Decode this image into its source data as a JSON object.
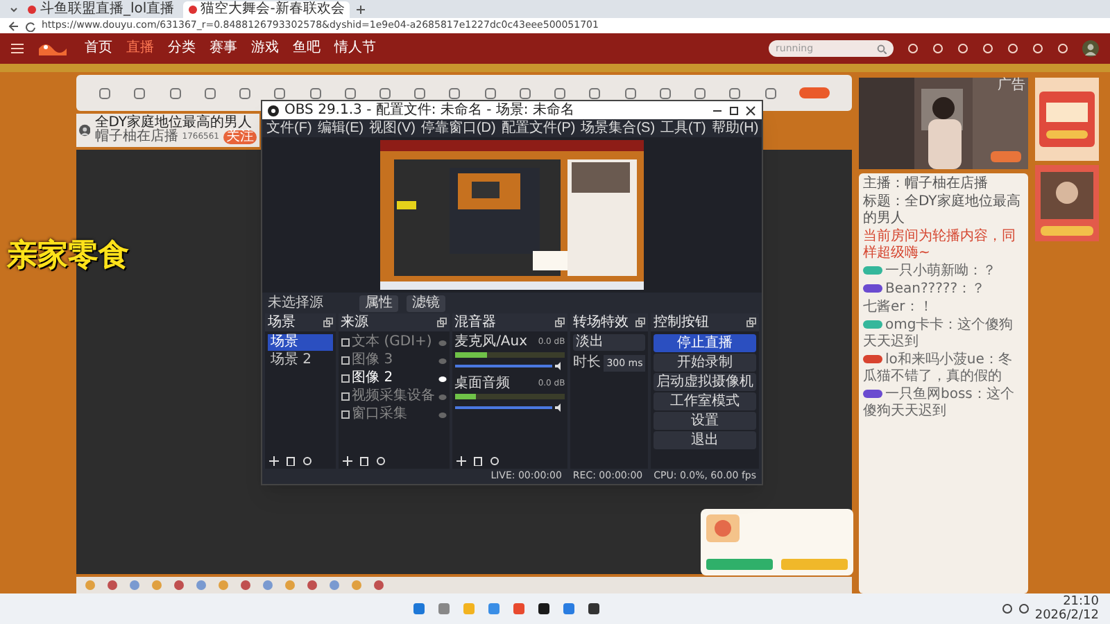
{
  "browser": {
    "tabs": [
      {
        "label": "斗鱼联盟直播_lol直播",
        "selected": false
      },
      {
        "label": "猫空大舞会-新春联欢会",
        "selected": true
      }
    ],
    "url": "https://www.douyu.com/631367_r=0.8488126793302578&dyshid=1e9e04-a2685817e1227dc0c43eee500051701"
  },
  "nav": [
    {
      "label": "首页",
      "selected": false
    },
    {
      "label": "直播",
      "selected": true
    },
    {
      "label": "分类",
      "selected": false
    },
    {
      "label": "赛事",
      "selected": false
    },
    {
      "label": "游戏",
      "selected": false
    },
    {
      "label": "鱼吧",
      "selected": false
    },
    {
      "label": "情人节",
      "selected": false
    }
  ],
  "search": {
    "placeholder": "running"
  },
  "room": {
    "title": "全DY家庭地位最高的男人",
    "follow": "关注",
    "streamer": "帽子柚在店播",
    "heat": "1766561"
  },
  "video": {
    "caption": "亲家零食"
  },
  "obs": {
    "title": "OBS 29.1.3 - 配置文件: 未命名 - 场景: 未命名",
    "menu": [
      "文件(F)",
      "编辑(E)",
      "视图(V)",
      "停靠窗口(D)",
      "配置文件(P)",
      "场景集合(S)",
      "工具(T)",
      "帮助(H)"
    ],
    "source_bar": {
      "label": "未选择源",
      "buttons": [
        "属性",
        "滤镜"
      ]
    },
    "docks": [
      "场景",
      "来源",
      "混音器",
      "转场特效",
      "控制按钮"
    ],
    "scenes": [
      {
        "label": "场景",
        "selected": true
      },
      {
        "label": "场景 2",
        "selected": false
      }
    ],
    "sources": [
      {
        "label": "文本 (GDI+)",
        "visible": false
      },
      {
        "label": "图像 3",
        "visible": false
      },
      {
        "label": "图像 2",
        "visible": true
      },
      {
        "label": "视频采集设备",
        "visible": false
      },
      {
        "label": "窗口采集",
        "visible": false
      }
    ],
    "mixer": [
      {
        "name": "麦克风/Aux",
        "reading": "0.0 dB",
        "meter": {
          "level": 0.3
        },
        "volume": {
          "level": 1
        }
      },
      {
        "name": "桌面音频",
        "reading": "0.0 dB",
        "meter": {
          "level": 0.2
        },
        "volume": {
          "level": 1
        }
      }
    ],
    "transition": {
      "type": "淡出",
      "duration_label": "时长",
      "duration": "300 ms"
    },
    "controls": [
      {
        "label": "停止直播",
        "active": true
      },
      {
        "label": "开始录制",
        "active": false
      },
      {
        "label": "启动虚拟摄像机",
        "active": false
      },
      {
        "label": "工作室模式",
        "active": false
      },
      {
        "label": "设置",
        "active": false
      },
      {
        "label": "退出",
        "active": false
      }
    ],
    "status": {
      "live": "LIVE: 00:00:00",
      "rec": "REC: 00:00:00",
      "cpu": "CPU: 0.0%, 60.00 fps"
    }
  },
  "ad": {
    "label": "广告"
  },
  "chat": {
    "info": [
      "主播：帽子柚在店播",
      "标题：全DY家庭地位最高的男人"
    ],
    "notice": "当前房间为轮播内容，同样超级嗨~",
    "messages": [
      {
        "user": "一只小萌新呦：",
        "text": "？",
        "color": "#35b79b"
      },
      {
        "user": "Bean?????：",
        "text": "？",
        "color": "#6b4bd0"
      },
      {
        "user": "七酱er：",
        "text": "！"
      },
      {
        "user": "omg卡卡：",
        "text": "这个傻狗天天迟到",
        "color": "#35b79b"
      },
      {
        "user": "lo和来吗小菠ue：",
        "text": "冬瓜猫不错了，真的假的",
        "color": "#d8432f"
      },
      {
        "user": "一只鱼网boss：",
        "text": "这个傻狗天天迟到",
        "color": "#6b4bd0"
      }
    ]
  },
  "taskbar": {
    "time": "21:10",
    "date": "2026/2/12"
  }
}
